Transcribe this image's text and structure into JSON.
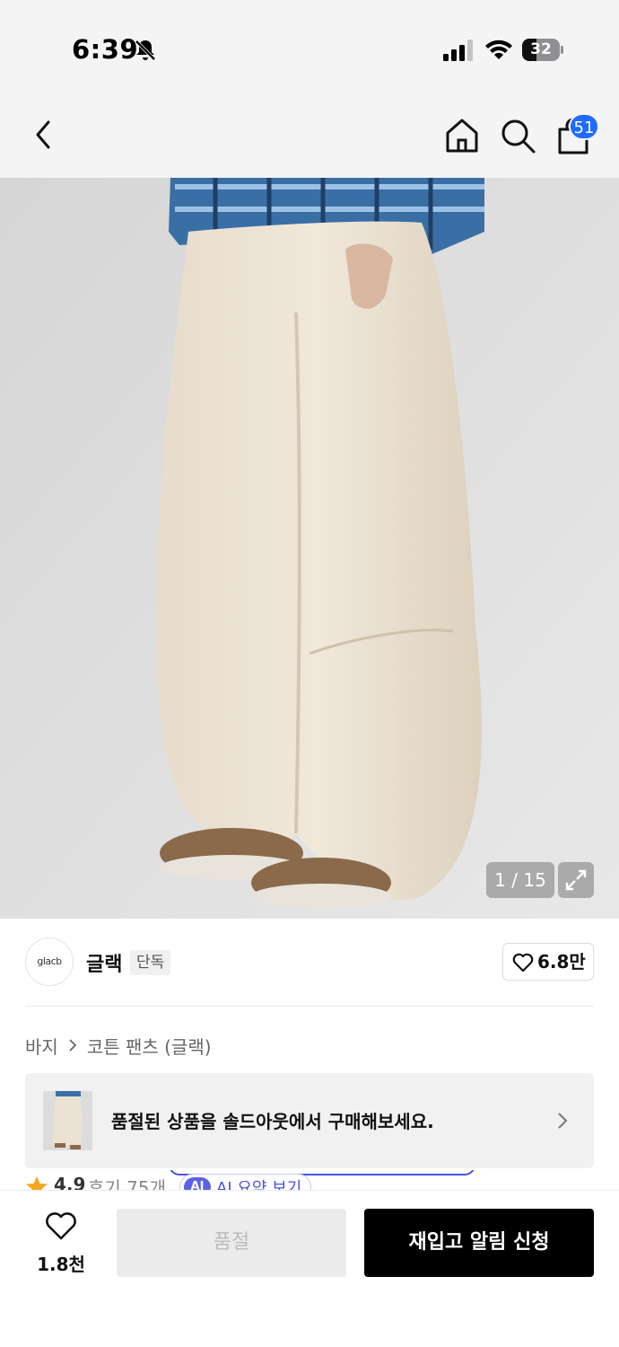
{
  "status_bar": {
    "time": "6:39",
    "battery_level": "32",
    "icons": [
      "bell-muted-icon",
      "signal-icon",
      "wifi-icon",
      "battery-icon"
    ]
  },
  "nav": {
    "icons": [
      "chevron-left-icon",
      "home-icon",
      "search-icon",
      "shopping-bag-icon"
    ],
    "cart_count": "51"
  },
  "gallery": {
    "counter": "1 / 15",
    "expand_icon": "expand-icon"
  },
  "brand": {
    "logo_text": "glacb",
    "name": "글랙",
    "badge": "단독",
    "likes": "6.8만"
  },
  "breadcrumb": {
    "category": "바지",
    "subcategory": "코튼 팬츠 (글랙)"
  },
  "soldout_banner": {
    "message": "품절된 상품을 솔드아웃에서 구매해보세요."
  },
  "reviews": {
    "rating": "4.9",
    "count": "후기 75개",
    "ai_chip": "AI",
    "ai_label": "AI 요약 보기"
  },
  "bottom_bar": {
    "wish_count": "1.8천",
    "soldout_label": "품절",
    "restock_label": "재입고 알림 신청"
  },
  "colors": {
    "accent_blue": "#1f6bff",
    "ai_purple": "#5b62e6",
    "restock_button": "#000000",
    "soldout_button": "#ebebeb"
  }
}
